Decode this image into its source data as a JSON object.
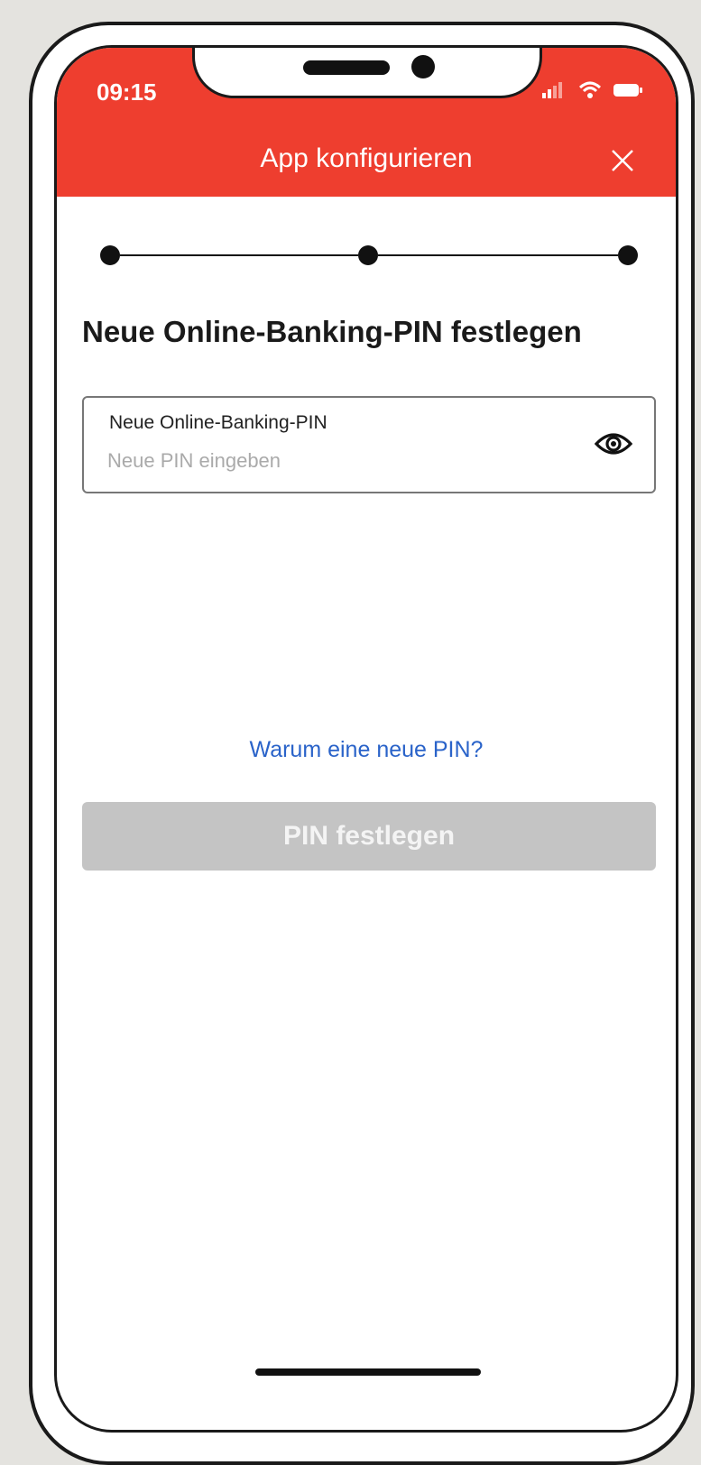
{
  "status_bar": {
    "time": "09:15",
    "icons": [
      "signal-icon",
      "wifi-icon",
      "battery-icon"
    ]
  },
  "header": {
    "title": "App konfigurieren",
    "close_icon": "close-icon",
    "background_color": "#ee3e2f"
  },
  "stepper": {
    "steps": 3,
    "current_step": 2
  },
  "main": {
    "section_title": "Neue Online-Banking-PIN festlegen",
    "pin_field": {
      "label": "Neue Online-Banking-PIN",
      "value": "",
      "placeholder": "Neue PIN eingeben",
      "toggle_icon": "eye-icon"
    },
    "help_link": "Warum eine neue PIN?",
    "submit_label": "PIN festlegen",
    "submit_enabled": false
  },
  "colors": {
    "accent": "#ee3e2f",
    "link": "#2a63c9",
    "disabled_button": "#c4c4c4"
  }
}
